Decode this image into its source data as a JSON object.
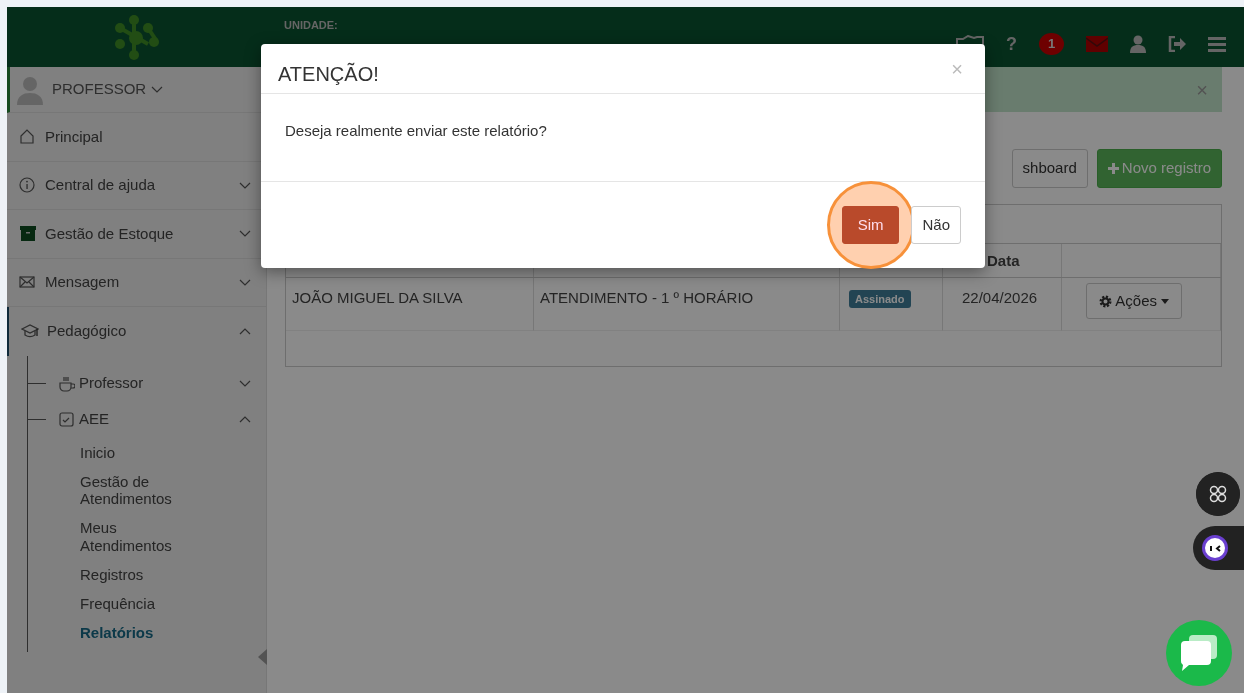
{
  "header": {
    "unit_label": "UNIDADE:",
    "help": "?",
    "notification_count": "1"
  },
  "user": {
    "role": "PROFESSOR"
  },
  "sidebar": {
    "items": [
      {
        "label": "Principal",
        "kind": "link"
      },
      {
        "label": "Central de ajuda",
        "kind": "group",
        "expanded": false
      },
      {
        "label": "Gestão de Estoque",
        "kind": "group",
        "expanded": false
      },
      {
        "label": "Mensagem",
        "kind": "group",
        "expanded": false
      },
      {
        "label": "Pedagógico",
        "kind": "group",
        "expanded": true,
        "children": [
          {
            "label": "Professor",
            "kind": "group",
            "expanded": false
          },
          {
            "label": "AEE",
            "kind": "group",
            "expanded": true,
            "children": [
              {
                "label": "Inicio",
                "selected": false
              },
              {
                "label": "Gestão de Atendimentos",
                "selected": false
              },
              {
                "label": "Meus Atendimentos",
                "selected": false
              },
              {
                "label": "Registros",
                "selected": false
              },
              {
                "label": "Frequência",
                "selected": false
              },
              {
                "label": "Relatórios",
                "selected": true
              }
            ]
          }
        ]
      }
    ]
  },
  "alert": {
    "close": "×"
  },
  "toolbar": [
    {
      "label": "shboard",
      "kind": "default"
    },
    {
      "label": "Novo registro",
      "kind": "success"
    }
  ],
  "table": {
    "date_column": "Data",
    "rows": [
      {
        "student": "JOÃO MIGUEL DA SILVA",
        "service": "ATENDIMENTO - 1 º HORÁRIO",
        "status": "Assinado",
        "date": "22/04/2026",
        "action": "Ações"
      }
    ]
  },
  "modal": {
    "title": "ATENÇÃO!",
    "close": "×",
    "message": "Deseja realmente enviar este relatório?",
    "buttons": [
      {
        "label": "Sim",
        "kind": "danger",
        "highlighted": true
      },
      {
        "label": "Não",
        "kind": "default",
        "highlighted": false
      }
    ]
  }
}
